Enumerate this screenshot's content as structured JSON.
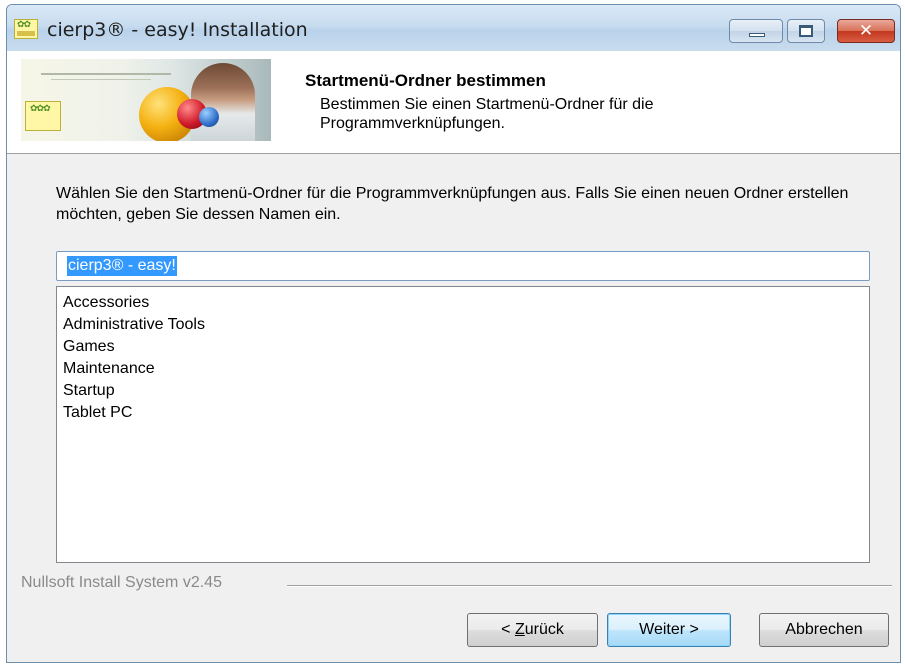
{
  "window": {
    "title": "cierp3® - easy! Installation"
  },
  "header": {
    "title": "Startmenü-Ordner bestimmen",
    "subtitle": "Bestimmen Sie einen Startmenü-Ordner für die Programmverknüpfungen."
  },
  "main": {
    "instruction": "Wählen Sie den Startmenü-Ordner für die Programmverknüpfungen aus. Falls Sie einen neuen Ordner erstellen möchten, geben Sie dessen Namen ein.",
    "folder_name_value": "cierp3® - easy!",
    "folders": [
      "Accessories",
      "Administrative Tools",
      "Games",
      "Maintenance",
      "Startup",
      "Tablet PC"
    ]
  },
  "footer": {
    "branding": "Nullsoft Install System v2.45",
    "back_prefix": "< ",
    "back_mnemonic": "Z",
    "back_rest": "urück",
    "next_label": "Weiter >",
    "cancel_label": "Abbrechen"
  },
  "colors": {
    "selection": "#3399ff",
    "default_button_border": "#3c7fb1",
    "close_button": "#c2381f"
  }
}
